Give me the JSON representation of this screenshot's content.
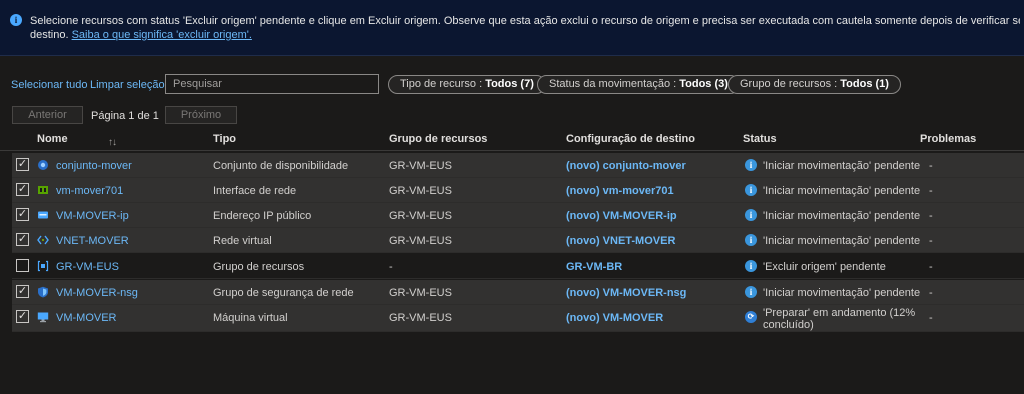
{
  "banner": {
    "text": "Selecione recursos com status 'Excluir origem' pendente e clique em Excluir origem. Observe que esta ação exclui o recurso de origem e precisa ser executada com cautela somente depois de verificar se você moveu os recursos relevantes para o",
    "text_line2": "destino.",
    "link": "Saiba o que significa 'excluir origem'."
  },
  "toolbar": {
    "select_all": "Selecionar tudo",
    "clear_selection": "Limpar seleção",
    "search_placeholder": "Pesquisar",
    "filters": [
      {
        "label": "Tipo de recurso : ",
        "value": "Todos (7)"
      },
      {
        "label": "Status da movimentação : ",
        "value": "Todos (3)"
      },
      {
        "label": "Grupo de recursos : ",
        "value": "Todos (1)"
      }
    ]
  },
  "pager": {
    "previous": "Anterior",
    "page_label": "Página 1 de 1",
    "next": "Próximo"
  },
  "table": {
    "headers": {
      "name": "Nome",
      "sort": "↑↓",
      "type": "Tipo",
      "group": "Grupo de recursos",
      "dest": "Configuração de destino",
      "status": "Status",
      "problems": "Problemas"
    },
    "rows": [
      {
        "name": "conjunto-mover",
        "type": "Conjunto de disponibilidade",
        "group": "GR-VM-EUS",
        "dest": "(novo) conjunto-mover",
        "status": "'Iniciar movimentação' pendente",
        "problems": "-",
        "checked": true,
        "icon": "availability-set-icon"
      },
      {
        "name": "vm-mover701",
        "type": "Interface de rede",
        "group": "GR-VM-EUS",
        "dest": "(novo) vm-mover701",
        "status": "'Iniciar movimentação' pendente",
        "problems": "-",
        "checked": true,
        "icon": "network-interface-icon"
      },
      {
        "name": "VM-MOVER-ip",
        "type": "Endereço IP público",
        "group": "GR-VM-EUS",
        "dest": "(novo) VM-MOVER-ip",
        "status": "'Iniciar movimentação' pendente",
        "problems": "-",
        "checked": true,
        "icon": "public-ip-icon"
      },
      {
        "name": "VNET-MOVER",
        "type": "Rede virtual",
        "group": "GR-VM-EUS",
        "dest": "(novo) VNET-MOVER",
        "status": "'Iniciar movimentação' pendente",
        "problems": "-",
        "checked": true,
        "icon": "virtual-network-icon"
      },
      {
        "name": "GR-VM-EUS",
        "type": "Grupo de recursos",
        "group": "-",
        "dest": "GR-VM-BR",
        "status": "'Excluir origem' pendente",
        "problems": "-",
        "checked": false,
        "icon": "resource-group-icon"
      },
      {
        "name": "VM-MOVER-nsg",
        "type": "Grupo de segurança de rede",
        "group": "GR-VM-EUS",
        "dest": "(novo) VM-MOVER-nsg",
        "status": "'Iniciar movimentação' pendente",
        "problems": "-",
        "checked": true,
        "icon": "network-security-group-icon"
      },
      {
        "name": "VM-MOVER",
        "type": "Máquina virtual",
        "group": "GR-VM-EUS",
        "dest": "(novo) VM-MOVER",
        "status": "'Preparar' em andamento (12%",
        "status_line2": "concluído)",
        "problems": "-",
        "checked": true,
        "icon": "virtual-machine-icon"
      }
    ]
  }
}
